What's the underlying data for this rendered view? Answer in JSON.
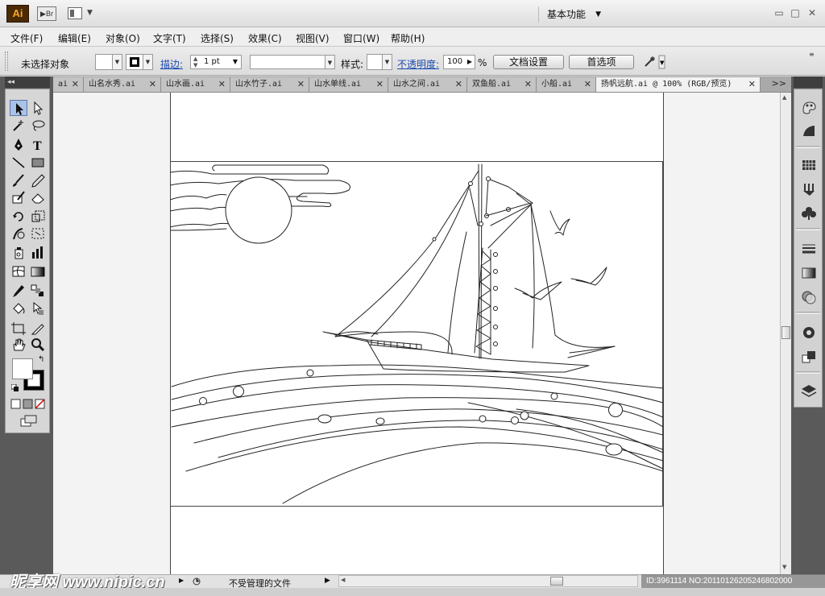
{
  "app": {
    "logo": "Ai",
    "bridge": "Br",
    "workspace": "基本功能"
  },
  "window_controls": {
    "minimize": "▭",
    "restore": "□",
    "close": "✕"
  },
  "menu": [
    "文件(F)",
    "编辑(E)",
    "对象(O)",
    "文字(T)",
    "选择(S)",
    "效果(C)",
    "视图(V)",
    "窗口(W)",
    "帮助(H)"
  ],
  "control": {
    "selection": "未选择对象",
    "stroke_label": "描边:",
    "stroke_value": "1 pt",
    "style_label": "样式:",
    "opacity_label": "不透明度:",
    "opacity_value": "100",
    "percent": "%",
    "doc_setup": "文档设置",
    "preferences": "首选项"
  },
  "tabs": [
    {
      "label": "ai",
      "active": false
    },
    {
      "label": "山名水秀.ai",
      "active": false
    },
    {
      "label": "山水画.ai",
      "active": false
    },
    {
      "label": "山水竹子.ai",
      "active": false
    },
    {
      "label": "山水单线.ai",
      "active": false
    },
    {
      "label": "山水之间.ai",
      "active": false
    },
    {
      "label": "双鱼船.ai",
      "active": false
    },
    {
      "label": "小船.ai",
      "active": false
    },
    {
      "label": "扬帆远航.ai @ 100% (RGB/预览)",
      "active": true
    }
  ],
  "tab_more": ">>",
  "tools": [
    "selection-tool",
    "direct-selection-tool",
    "magic-wand-tool",
    "lasso-tool",
    "pen-tool",
    "type-tool",
    "line-tool",
    "rectangle-tool",
    "paintbrush-tool",
    "pencil-tool",
    "blob-brush-tool",
    "eraser-tool",
    "rotate-tool",
    "scale-tool",
    "warp-tool",
    "free-transform-tool",
    "symbol-sprayer-tool",
    "column-graph-tool",
    "mesh-tool",
    "gradient-tool",
    "eyedropper-tool",
    "blend-tool",
    "live-paint-bucket-tool",
    "live-paint-selection-tool",
    "artboard-tool",
    "slice-tool",
    "hand-tool",
    "zoom-tool"
  ],
  "right_panels": [
    "color-icon",
    "color-guide-icon",
    "swatches-icon",
    "brushes-icon",
    "symbols-icon",
    "stroke-icon",
    "gradient-icon",
    "transparency-icon",
    "appearance-icon",
    "graphic-styles-icon",
    "layers-icon"
  ],
  "status": {
    "file_state": "不受管理的文件"
  },
  "watermark": {
    "left": "昵享网 www.nipic.cn",
    "right": "ID:3961114 NO:20110126205246802000"
  }
}
